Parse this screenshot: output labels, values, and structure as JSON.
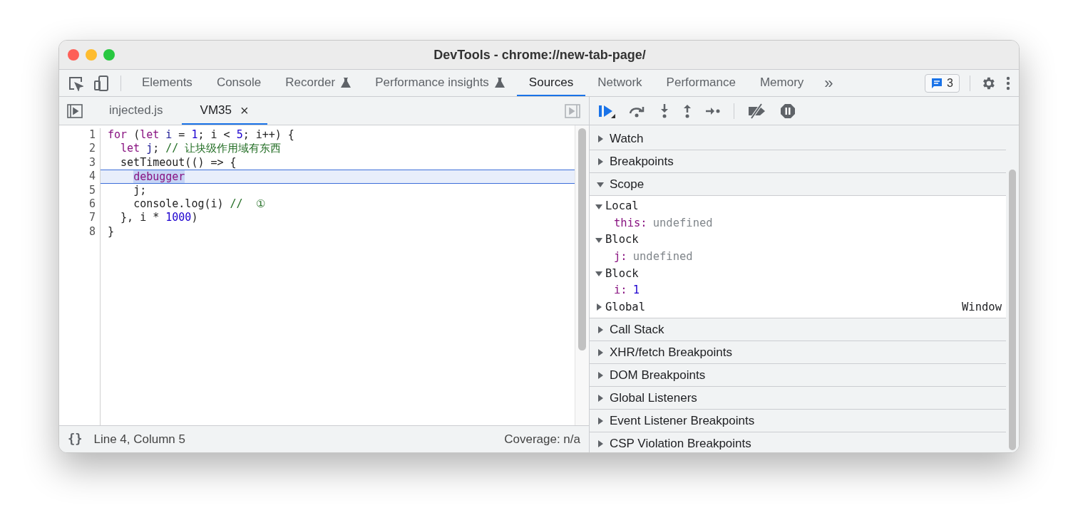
{
  "window": {
    "title": "DevTools - chrome://new-tab-page/"
  },
  "tabs": [
    {
      "label": "Elements",
      "selected": false,
      "experimental": false
    },
    {
      "label": "Console",
      "selected": false,
      "experimental": false
    },
    {
      "label": "Recorder",
      "selected": false,
      "experimental": true
    },
    {
      "label": "Performance insights",
      "selected": false,
      "experimental": true
    },
    {
      "label": "Sources",
      "selected": true,
      "experimental": false
    },
    {
      "label": "Network",
      "selected": false,
      "experimental": false
    },
    {
      "label": "Performance",
      "selected": false,
      "experimental": false
    },
    {
      "label": "Memory",
      "selected": false,
      "experimental": false
    }
  ],
  "more_tabs": "»",
  "messages_badge": "3",
  "file_tabs": [
    {
      "label": "injected.js",
      "selected": false,
      "closable": false
    },
    {
      "label": "VM35",
      "selected": true,
      "closable": true
    }
  ],
  "close_glyph": "×",
  "code_lines": [
    {
      "number": "1",
      "paused": false,
      "tokens": [
        {
          "t": "for",
          "kind": "kw"
        },
        {
          "t": " (",
          "kind": "plain"
        },
        {
          "t": "let",
          "kind": "kw"
        },
        {
          "t": " i",
          "kind": "var"
        },
        {
          "t": " = ",
          "kind": "plain"
        },
        {
          "t": "1",
          "kind": "num"
        },
        {
          "t": "; i < ",
          "kind": "plain"
        },
        {
          "t": "5",
          "kind": "num"
        },
        {
          "t": "; i++) {",
          "kind": "plain"
        }
      ]
    },
    {
      "number": "2",
      "paused": false,
      "tokens": [
        {
          "t": "  let",
          "kind": "kw"
        },
        {
          "t": " j",
          "kind": "var"
        },
        {
          "t": "; ",
          "kind": "plain"
        },
        {
          "t": "// 让块级作用域有东西",
          "kind": "comment"
        }
      ]
    },
    {
      "number": "3",
      "paused": false,
      "tokens": [
        {
          "t": "  setTimeout(() => {",
          "kind": "plain"
        }
      ]
    },
    {
      "number": "4",
      "paused": true,
      "tokens": [
        {
          "t": "    debugger",
          "kind": "kw"
        }
      ]
    },
    {
      "number": "5",
      "paused": false,
      "tokens": [
        {
          "t": "    j;",
          "kind": "plain"
        }
      ]
    },
    {
      "number": "6",
      "paused": false,
      "tokens": [
        {
          "t": "    console.log(i) ",
          "kind": "plain"
        },
        {
          "t": "//  ①",
          "kind": "comment"
        }
      ]
    },
    {
      "number": "7",
      "paused": false,
      "tokens": [
        {
          "t": "  }, i * ",
          "kind": "plain"
        },
        {
          "t": "1000",
          "kind": "num"
        },
        {
          "t": ")",
          "kind": "plain"
        }
      ]
    },
    {
      "number": "8",
      "paused": false,
      "tokens": [
        {
          "t": "}",
          "kind": "plain"
        }
      ]
    }
  ],
  "status_bar": {
    "format_glyph": "{}",
    "position": "Line 4, Column 5",
    "coverage": "Coverage: n/a"
  },
  "sections_before": [
    {
      "title": "Watch",
      "expanded": false
    },
    {
      "title": "Breakpoints",
      "expanded": false
    },
    {
      "title": "Scope",
      "expanded": true
    }
  ],
  "scope": [
    {
      "name": "Local",
      "expanded": true,
      "props": [
        {
          "key": "this:",
          "value": "undefined",
          "kind": "undef"
        }
      ]
    },
    {
      "name": "Block",
      "expanded": true,
      "props": [
        {
          "key": "j:",
          "value": "undefined",
          "kind": "undef"
        }
      ]
    },
    {
      "name": "Block",
      "expanded": true,
      "props": [
        {
          "key": "i:",
          "value": "1",
          "kind": "num"
        }
      ]
    },
    {
      "name": "Global",
      "expanded": false,
      "value": "Window"
    }
  ],
  "sections_after": [
    {
      "title": "Call Stack",
      "expanded": false
    },
    {
      "title": "XHR/fetch Breakpoints",
      "expanded": false
    },
    {
      "title": "DOM Breakpoints",
      "expanded": false
    },
    {
      "title": "Global Listeners",
      "expanded": false
    },
    {
      "title": "Event Listener Breakpoints",
      "expanded": false
    },
    {
      "title": "CSP Violation Breakpoints",
      "expanded": false
    }
  ]
}
